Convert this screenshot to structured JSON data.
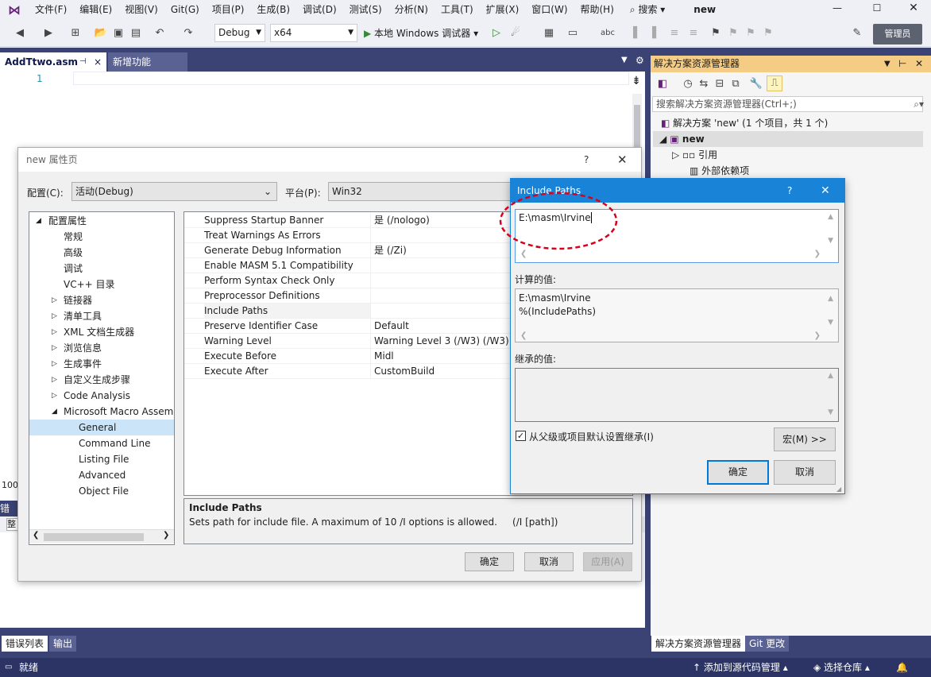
{
  "menus": [
    "文件(F)",
    "编辑(E)",
    "视图(V)",
    "Git(G)",
    "项目(P)",
    "生成(B)",
    "调试(D)",
    "测试(S)",
    "分析(N)",
    "工具(T)",
    "扩展(X)",
    "窗口(W)",
    "帮助(H)"
  ],
  "search_label": "搜索",
  "solution_name_top": "new",
  "toolbar": {
    "config": "Debug",
    "platform": "x64",
    "run_label": "本地 Windows 调试器",
    "admin": "管理员"
  },
  "doc_tabs": {
    "active": "AddTtwo.asm",
    "other": "新增功能"
  },
  "editor": {
    "line1": "1",
    "zoom": "100"
  },
  "solution_explorer": {
    "title": "解决方案资源管理器",
    "search_placeholder": "搜索解决方案资源管理器(Ctrl+;)",
    "solution_row": "解决方案 'new' (1 个项目，共 1 个)",
    "project": "new",
    "references": "引用",
    "external_deps": "外部依赖项"
  },
  "bottom_tabs": {
    "errors": "错误列表",
    "output": "输出",
    "sol": "解决方案资源管理器",
    "git": "Git 更改",
    "errors_short": "错误"
  },
  "status": {
    "ready": "就绪",
    "add_source": "添加到源代码管理",
    "select_repo": "选择仓库"
  },
  "prop_dialog": {
    "title": "new 属性页",
    "help": "?",
    "config_label": "配置(C):",
    "config_value": "活动(Debug)",
    "platform_label": "平台(P):",
    "platform_value": "Win32",
    "tree": [
      {
        "label": "配置属性",
        "indent": 0,
        "arrow": "◢"
      },
      {
        "label": "常规",
        "indent": 1,
        "arrow": ""
      },
      {
        "label": "高级",
        "indent": 1,
        "arrow": ""
      },
      {
        "label": "调试",
        "indent": 1,
        "arrow": ""
      },
      {
        "label": "VC++ 目录",
        "indent": 1,
        "arrow": ""
      },
      {
        "label": "链接器",
        "indent": 1,
        "arrow": "▷"
      },
      {
        "label": "清单工具",
        "indent": 1,
        "arrow": "▷"
      },
      {
        "label": "XML 文档生成器",
        "indent": 1,
        "arrow": "▷"
      },
      {
        "label": "浏览信息",
        "indent": 1,
        "arrow": "▷"
      },
      {
        "label": "生成事件",
        "indent": 1,
        "arrow": "▷"
      },
      {
        "label": "自定义生成步骤",
        "indent": 1,
        "arrow": "▷"
      },
      {
        "label": "Code Analysis",
        "indent": 1,
        "arrow": "▷"
      },
      {
        "label": "Microsoft Macro Assem",
        "indent": 1,
        "arrow": "◢"
      },
      {
        "label": "General",
        "indent": 2,
        "arrow": "",
        "selected": true
      },
      {
        "label": "Command Line",
        "indent": 2,
        "arrow": ""
      },
      {
        "label": "Listing File",
        "indent": 2,
        "arrow": ""
      },
      {
        "label": "Advanced",
        "indent": 2,
        "arrow": ""
      },
      {
        "label": "Object File",
        "indent": 2,
        "arrow": ""
      }
    ],
    "grid": [
      {
        "name": "Suppress Startup Banner",
        "value": "是 (/nologo)"
      },
      {
        "name": "Treat Warnings As Errors",
        "value": ""
      },
      {
        "name": "Generate Debug Information",
        "value": "是 (/Zi)"
      },
      {
        "name": "Enable MASM 5.1 Compatibility",
        "value": ""
      },
      {
        "name": "Perform Syntax Check Only",
        "value": ""
      },
      {
        "name": "Preprocessor Definitions",
        "value": ""
      },
      {
        "name": "Include Paths",
        "value": ""
      },
      {
        "name": "Preserve Identifier Case",
        "value": "Default"
      },
      {
        "name": "Warning Level",
        "value": "Warning Level 3 (/W3) (/W3)"
      },
      {
        "name": "Execute Before",
        "value": "Midl"
      },
      {
        "name": "Execute After",
        "value": "CustomBuild"
      }
    ],
    "desc_title": "Include Paths",
    "desc_text": "Sets path for include file. A maximum of 10 /I options is allowed.     (/I [path])",
    "ok": "确定",
    "cancel": "取消",
    "apply": "应用(A)"
  },
  "inc_dialog": {
    "title": "Include Paths",
    "help": "?",
    "edit_value": "E:\\masm\\Irvine",
    "computed_label": "计算的值:",
    "computed_1": "E:\\masm\\Irvine",
    "computed_2": "%(IncludePaths)",
    "inherited_label": "继承的值:",
    "inherit_checkbox": "从父级或项目默认设置继承(I)",
    "inherit_checked": true,
    "macro_btn": "宏(M) >>",
    "ok": "确定",
    "cancel": "取消",
    "highlight_color": "#d9001b"
  }
}
